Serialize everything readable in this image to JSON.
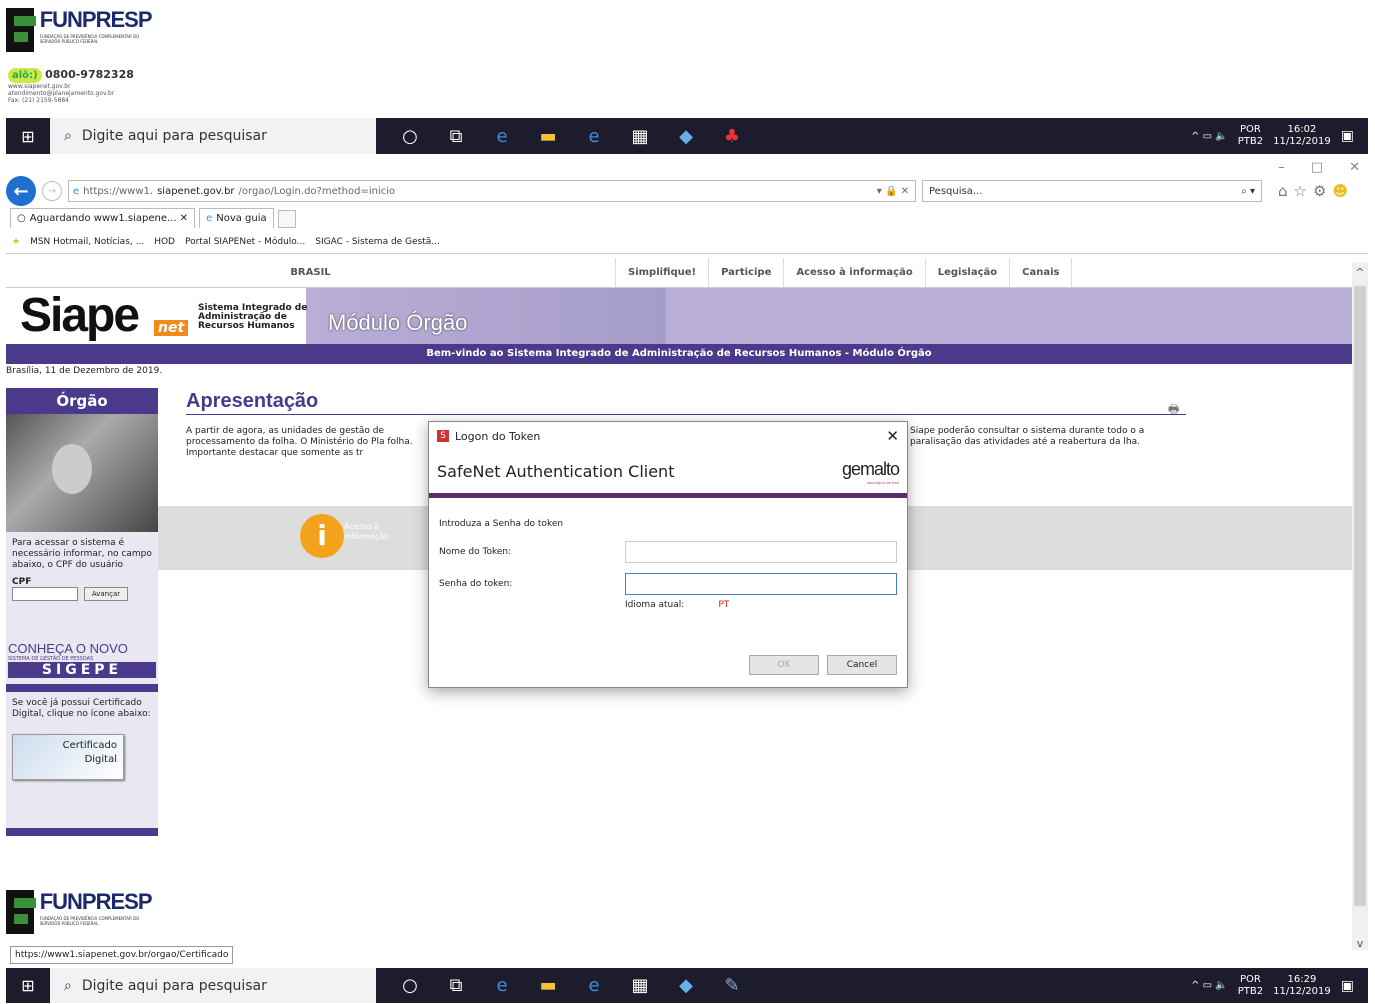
{
  "logo": {
    "name": "FUNPRESP",
    "tagline": "FUNDAÇÃO DE PREVIDÊNCIA COMPLEMENTAR DO SERVIDOR PÚBLICO FEDERAL"
  },
  "contact": {
    "badge": "alô:)",
    "phone": "0800-9782328",
    "site": "www.siapenet.gov.br",
    "email": "atendimento@planejamento.gov.br",
    "fax": "Fax: (21) 2159-5884"
  },
  "taskbar_top": {
    "search": "Digite aqui para pesquisar",
    "lang1": "POR",
    "lang2": "PTB2",
    "time": "16:02",
    "date": "11/12/2019"
  },
  "taskbar_bottom": {
    "search": "Digite aqui para pesquisar",
    "lang1": "POR",
    "lang2": "PTB2",
    "time": "16:29",
    "date": "11/12/2019"
  },
  "browser": {
    "url_prefix": "https://www1.",
    "url_domain": "siapenet.gov.br",
    "url_path": "/orgao/Login.do?method=inicio",
    "url_right": "▾ 🔒 ✕",
    "search_placeholder": "Pesquisa...",
    "tabs": [
      {
        "label": "Aguardando www1.siapene... ✕"
      },
      {
        "label": "Nova guia"
      }
    ],
    "favorites": [
      "MSN Hotmail, Notícias, ...",
      "HOD",
      "Portal SIAPENet - Módulo...",
      "SIGAC - Sistema de Gestã..."
    ]
  },
  "topmenu": {
    "brasil": "BRASIL",
    "items": [
      "Simplifique!",
      "Participe",
      "Acesso à informação",
      "Legislação",
      "Canais"
    ]
  },
  "banner": {
    "siape": "Siape",
    "net": "net",
    "sub1": "Sistema Integrado de",
    "sub2": "Administração de",
    "sub3": "Recursos Humanos",
    "module": "Módulo Órgão"
  },
  "welcome": "Bem-vindo ao Sistema Integrado de Administração de Recursos Humanos - Módulo Órgão",
  "date": "Brasília, 11 de Dezembro de 2019.",
  "sidebar": {
    "title": "Órgão",
    "text": "Para acessar o sistema é necessário informar, no campo abaixo, o CPF do usuário",
    "cpf_label": "CPF",
    "btn": "Avançar",
    "sig1": "CONHEÇA O NOVO",
    "sig2": "SISTEMA DE GESTÃO DE PESSOAS",
    "sig3": "SIGEPE",
    "cert_text": "Se você já possui Certificado Digital, clique no ícone abaixo:",
    "cert1": "Certificado",
    "cert2": "Digital"
  },
  "main": {
    "title": "Apresentação",
    "para_left": "A partir de agora, as unidades de gestão de processamento da folha. O Ministério do Pla folha. Importante destacar que somente as tr",
    "para_right": "Siape poderão consultar o sistema durante todo o a paralisação das atividades até a reabertura da lha.",
    "info": "Acesso à informação"
  },
  "statusbar": "https://www1.siapenet.gov.br/orgao/Certificado",
  "dialog": {
    "title": "Logon do Token",
    "header": "SafeNet Authentication Client",
    "brand": "gemalto",
    "brand_sub": "security to be free",
    "intro": "Introduza a Senha do token",
    "name_label": "Nome do Token:",
    "pass_label": "Senha do token:",
    "lang_label": "Idioma atual:",
    "lang_value": "PT",
    "ok": "OK",
    "cancel": "Cancel"
  },
  "colors": {
    "accent": "#4b3a8c",
    "taskbar": "#1c1c2c",
    "dialog_bar": "#5a2a6e"
  }
}
